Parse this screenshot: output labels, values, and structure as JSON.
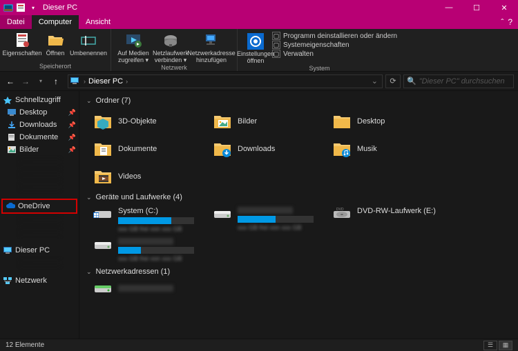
{
  "window": {
    "title": "Dieser PC"
  },
  "menu": {
    "file": "Datei",
    "computer": "Computer",
    "view": "Ansicht"
  },
  "ribbon": {
    "group_speicherort": {
      "label": "Speicherort",
      "eigenschaften": "Eigenschaften",
      "oeffnen": "Öffnen",
      "umbenennen": "Umbenennen"
    },
    "group_netzwerk": {
      "label": "Netzwerk",
      "auf_medien": "Auf Medien zugreifen ▾",
      "netzlaufwerk": "Netzlaufwerk verbinden ▾",
      "netzwerkadresse": "Netzwerkadresse hinzufügen"
    },
    "group_system": {
      "label": "System",
      "einstellungen": "Einstellungen öffnen",
      "link_uninstall": "Programm deinstallieren oder ändern",
      "link_syseig": "Systemeigenschaften",
      "link_verwalten": "Verwalten"
    }
  },
  "nav": {
    "breadcrumb": "Dieser PC",
    "search_placeholder": "\"Dieser PC\" durchsuchen"
  },
  "sidebar": {
    "quick": "Schnellzugriff",
    "desktop": "Desktop",
    "downloads": "Downloads",
    "dokumente": "Dokumente",
    "bilder": "Bilder",
    "onedrive": "OneDrive",
    "this_pc": "Dieser PC",
    "network": "Netzwerk"
  },
  "content": {
    "section_folders": "Ordner (7)",
    "section_drives": "Geräte und Laufwerke (4)",
    "section_network": "Netzwerkadressen (1)",
    "folders": [
      {
        "label": "3D-Objekte"
      },
      {
        "label": "Bilder"
      },
      {
        "label": "Desktop"
      },
      {
        "label": "Dokumente"
      },
      {
        "label": "Downloads"
      },
      {
        "label": "Musik"
      },
      {
        "label": "Videos"
      }
    ],
    "drives": [
      {
        "label": "System (C:)",
        "fill": 70
      },
      {
        "label": "",
        "fill": 50
      },
      {
        "label": "DVD-RW-Laufwerk (E:)",
        "fill": null
      },
      {
        "label": "",
        "fill": 30
      }
    ]
  },
  "status": {
    "items": "12 Elemente"
  },
  "colors": {
    "accent": "#b80074",
    "highlight_border": "#d40000",
    "drive_fill": "#0099e5",
    "folder_yellow": "#f5c96f",
    "folder_front": "#f0b84a"
  }
}
